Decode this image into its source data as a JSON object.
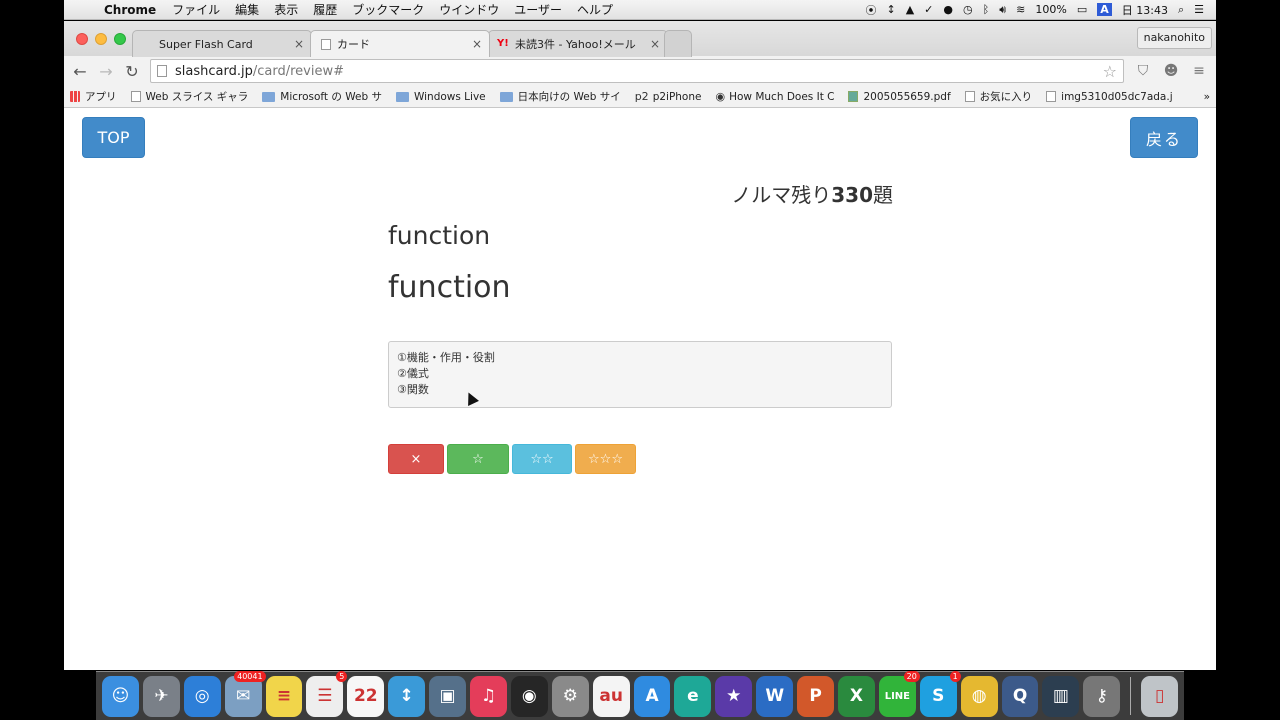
{
  "menubar": {
    "app_name": "Chrome",
    "items": [
      "ファイル",
      "編集",
      "表示",
      "履歴",
      "ブックマーク",
      "ウインドウ",
      "ユーザー",
      "ヘルプ"
    ],
    "battery": "100%",
    "input_method": "A",
    "clock": "日 13:43"
  },
  "browser": {
    "tabs": [
      {
        "title": "Super Flash Card",
        "active": false
      },
      {
        "title": "カード",
        "active": true
      },
      {
        "title": "未読3件 - Yahoo!メール",
        "active": false
      }
    ],
    "user_name": "nakanohito",
    "url_host": "slashcard.jp",
    "url_path": "/card/review#",
    "bookmarks": [
      {
        "label": "アプリ",
        "icon": "apps-icon"
      },
      {
        "label": "Web スライス ギャラ",
        "icon": "page-icon"
      },
      {
        "label": "Microsoft の Web サ",
        "icon": "folder-icon"
      },
      {
        "label": "Windows Live",
        "icon": "folder-icon"
      },
      {
        "label": "日本向けの Web サイ",
        "icon": "folder-icon"
      },
      {
        "label": "p2iPhone",
        "icon": "p2-icon"
      },
      {
        "label": "How Much Does It C",
        "icon": "globe-icon"
      },
      {
        "label": "2005055659.pdf",
        "icon": "image-icon"
      },
      {
        "label": "お気に入り",
        "icon": "page-icon"
      },
      {
        "label": "img5310d05dc7ada.j",
        "icon": "page-icon"
      }
    ],
    "bookmarks_more": "»"
  },
  "page": {
    "top_button": "TOP",
    "back_button": "戻る",
    "quota_prefix": "ノルマ残り",
    "quota_count": "330",
    "quota_suffix": "題",
    "word_front": "function",
    "word_back": "function",
    "meanings": [
      "①機能・作用・役割",
      "②儀式",
      "③関数"
    ],
    "ratings": {
      "wrong": "×",
      "one_star": "☆",
      "two_star": "☆☆",
      "three_star": "☆☆☆"
    },
    "colors": {
      "primary": "#428bca",
      "danger": "#d9534f",
      "success": "#5cb85c",
      "info": "#5bc0de",
      "warning": "#f0ad4e"
    }
  },
  "dock": {
    "items": [
      {
        "name": "finder-icon",
        "color": "#3b8fe0",
        "glyph": "☺"
      },
      {
        "name": "launchpad-icon",
        "color": "#7a8088",
        "glyph": "✈"
      },
      {
        "name": "safari-icon",
        "color": "#2d7fd8",
        "glyph": "◎"
      },
      {
        "name": "mail-icon",
        "color": "#7c9fc2",
        "glyph": "✉",
        "badge": "40041"
      },
      {
        "name": "notes-icon",
        "color": "#f1d54a",
        "glyph": "≡"
      },
      {
        "name": "reminders-icon",
        "color": "#eeeeee",
        "glyph": "☰",
        "badge": "5"
      },
      {
        "name": "calendar-icon",
        "color": "#f7f7f7",
        "glyph": "22"
      },
      {
        "name": "resize-icon",
        "color": "#3a9ad8",
        "glyph": "↕"
      },
      {
        "name": "photos-icon",
        "color": "#55708a",
        "glyph": "▣"
      },
      {
        "name": "itunes-icon",
        "color": "#e43d5a",
        "glyph": "♫"
      },
      {
        "name": "dvd-icon",
        "color": "#262626",
        "glyph": "◉"
      },
      {
        "name": "system-preferences-icon",
        "color": "#8a8a8a",
        "glyph": "⚙"
      },
      {
        "name": "au-icon",
        "color": "#f4f4f4",
        "glyph": "au"
      },
      {
        "name": "app-store-icon",
        "color": "#2f8be0",
        "glyph": "A"
      },
      {
        "name": "evernote-icon",
        "color": "#1ea897",
        "glyph": "e"
      },
      {
        "name": "imovie-icon",
        "color": "#5a3aa8",
        "glyph": "★"
      },
      {
        "name": "word-icon",
        "color": "#2b6cc4",
        "glyph": "W"
      },
      {
        "name": "powerpoint-icon",
        "color": "#d2582a",
        "glyph": "P"
      },
      {
        "name": "excel-icon",
        "color": "#2a8a3e",
        "glyph": "X"
      },
      {
        "name": "line-icon",
        "color": "#31b43a",
        "glyph": "LINE",
        "badge": "20"
      },
      {
        "name": "skype-icon",
        "color": "#1fa0e0",
        "glyph": "S",
        "badge": "1"
      },
      {
        "name": "chrome-icon",
        "color": "#e5b830",
        "glyph": "◍"
      },
      {
        "name": "quicktime-icon",
        "color": "#3c5a8a",
        "glyph": "Q"
      },
      {
        "name": "books-icon",
        "color": "#2c3e50",
        "glyph": "▥"
      },
      {
        "name": "keychain-icon",
        "color": "#777",
        "glyph": "⚷"
      },
      {
        "name": "trash-icon",
        "color": "#bfc4c8",
        "glyph": "▯"
      }
    ]
  }
}
